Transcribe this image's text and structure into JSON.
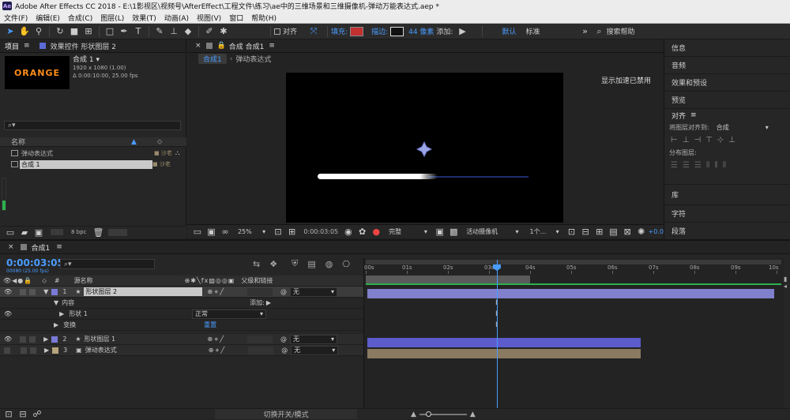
{
  "window": {
    "title": "Adobe After Effects CC 2018 - E:\\1影视区\\视频号\\AfterEffect\\工程文件\\练习\\ae中的三维场景和三维摄像机-弹动万能表达式.aep *"
  },
  "menu": [
    "文件(F)",
    "编辑(E)",
    "合成(C)",
    "图层(L)",
    "效果(T)",
    "动画(A)",
    "视图(V)",
    "窗口",
    "帮助(H)"
  ],
  "toolbar": {
    "align_label": "对齐",
    "fill_label": "填充:",
    "stroke_label": "描边:",
    "stroke_width": "44 像素",
    "add_label": "添加:",
    "workspace_default": "默认",
    "workspace_standard": "标准",
    "search_placeholder": "搜索帮助",
    "fill_color": "#c33030"
  },
  "project_panel": {
    "tab_project": "项目",
    "tab_effects": "效果控件 形状图层 2",
    "thumb_text": "ORANGE",
    "comp_name": "合成 1 ▾",
    "comp_size": "1920 x 1080 (1.00)",
    "comp_duration": "Δ 0:00:10:00, 25.00 fps",
    "col_name": "名称",
    "items": [
      {
        "name": "弹动表达式",
        "label": "■ 沙老"
      },
      {
        "name": "合成 1",
        "label": "■ 沙老"
      }
    ],
    "bpc": "8 bpc"
  },
  "viewer": {
    "tab_comp": "合成 合成1",
    "breadcrumb_active": "合成1",
    "breadcrumb_next": "弹动表达式",
    "gpu_notice": "显示加速已禁用",
    "zoom": "25%",
    "timecode": "0:00:03:05",
    "resolution": "完整",
    "camera": "活动摄像机",
    "views": "1个...",
    "exposure": "+0.0"
  },
  "right_panel": {
    "items": [
      "信息",
      "音频",
      "效果和预设",
      "预览",
      "对齐",
      "库",
      "字符",
      "段落"
    ],
    "align_to_label": "将图层对齐到:",
    "align_to_value": "合成",
    "distribute_label": "分布图层:"
  },
  "timeline": {
    "tab": "合成1",
    "timecode": "0:00:03:05",
    "timecode_sub": "00080 (25.00 fps)",
    "col_source": "源名称",
    "col_parent": "父级和链接",
    "ruler": [
      "00s",
      "01s",
      "02s",
      "03s",
      "04s",
      "05s",
      "06s",
      "07s",
      "08s",
      "09s",
      "10s"
    ],
    "layers": [
      {
        "num": "1",
        "name": "形状图层 2",
        "parent": "无",
        "color": "#7a7ad8"
      },
      {
        "num": "2",
        "name": "形状图层 1",
        "parent": "无",
        "color": "#7a7ad8"
      },
      {
        "num": "3",
        "name": "弹动表达式",
        "parent": "无",
        "color": "#b7a47a"
      }
    ],
    "contents_label": "内容",
    "add_label": "添加:",
    "shape_label": "形状 1",
    "blend_mode": "正常",
    "transform_label": "变换",
    "reset_label": "重置",
    "footer_toggle": "切换开关/模式"
  }
}
